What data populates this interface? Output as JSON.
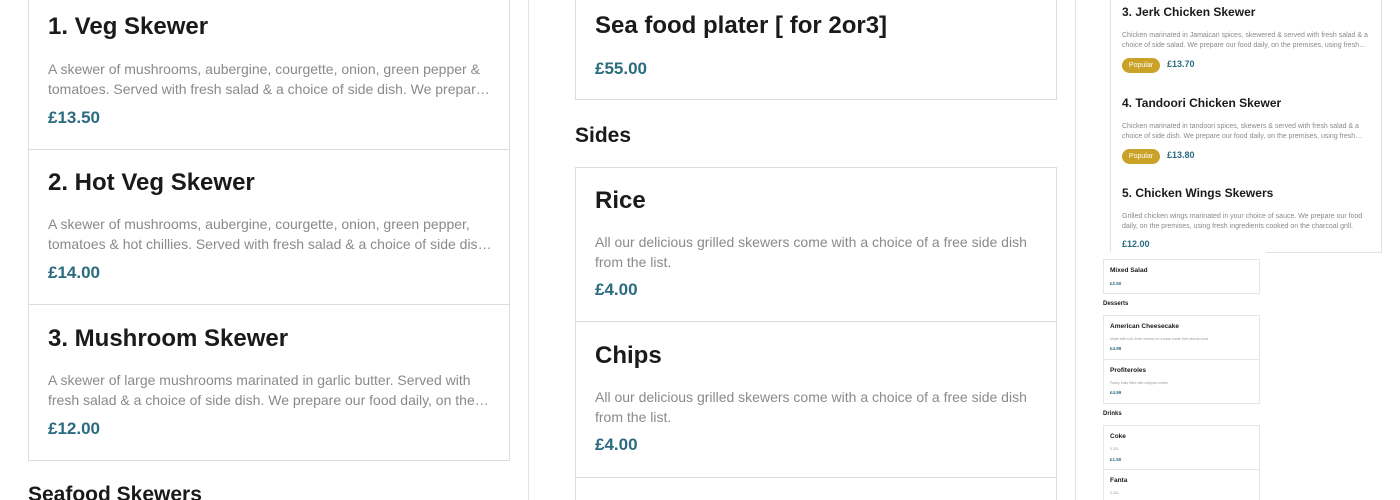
{
  "left_column": {
    "items": [
      {
        "title": "1. Veg Skewer",
        "description": "A skewer of mushrooms, aubergine, courgette, onion, green pepper & tomatoes. Served with fresh salad & a choice of side dish. We prepare our food daily, on the premises, using fresh ingredients.",
        "price": "£13.50"
      },
      {
        "title": "2. Hot Veg Skewer",
        "description": "A skewer of mushrooms, aubergine, courgette, onion, green pepper, tomatoes & hot chillies. Served with fresh salad & a choice of side dish. We prepare our food daily, on the premises.",
        "price": "£14.00"
      },
      {
        "title": "3. Mushroom Skewer",
        "description": "A skewer of large mushrooms marinated in garlic butter. Served with fresh salad & a choice of side dish. We prepare our food daily, on the premises, using fresh ingredients.",
        "price": "£12.00"
      }
    ],
    "next_section": "Seafood Skewers"
  },
  "middle_column": {
    "seafood_item": {
      "title": "Sea food plater [ for 2or3]",
      "price": "£55.00"
    },
    "section_heading": "Sides",
    "sides": [
      {
        "title": "Rice",
        "description": "All our delicious grilled skewers come with a choice of a free side dish from the list.",
        "price": "£4.00"
      },
      {
        "title": "Chips",
        "description": "All our delicious grilled skewers come with a choice of a free side dish from the list.",
        "price": "£4.00"
      }
    ]
  },
  "right_column": {
    "items": [
      {
        "title": "3. Jerk Chicken Skewer",
        "description": "Chicken marinated in Jamaican spices, skewered & served with fresh salad & a choice of side salad. We prepare our food daily, on the premises, using fresh ingredients.",
        "badge": "Popular",
        "price": "£13.70"
      },
      {
        "title": "4. Tandoori Chicken Skewer",
        "description": "Chicken marinated in tandoori spices, skewers & served with fresh salad & a choice of side dish. We prepare our food daily, on the premises, using fresh ingredients.",
        "badge": "Popular",
        "price": "£13.80"
      },
      {
        "title": "5. Chicken Wings Skewers",
        "description": "Grilled chicken wings marinated in your choice of sauce. We prepare our food daily, on the premises, using fresh ingredients cooked on the charcoal grill.",
        "price": "£12.00"
      }
    ]
  },
  "tiny_column": {
    "mixed_salad": {
      "title": "Mixed Salad",
      "price": "£2.50"
    },
    "desserts_heading": "Desserts",
    "desserts": [
      {
        "title": "American Cheesecake",
        "description": "Made with soft, fresh cheese on a base made from biscuit crust",
        "price": "£4.99"
      },
      {
        "title": "Profiteroles",
        "description": "Pastry balls filled with whipped cream",
        "price": "£4.99"
      }
    ],
    "drinks_heading": "Drinks",
    "drinks": [
      {
        "title": "Coke",
        "description": "0.33L",
        "price": "£1.50"
      },
      {
        "title": "Fanta",
        "description": "0.33L"
      }
    ]
  },
  "colors": {
    "price": "#2b6b80",
    "badge": "#c9a227",
    "border": "#dcdcdc",
    "muted_text": "#8a8a8a"
  }
}
